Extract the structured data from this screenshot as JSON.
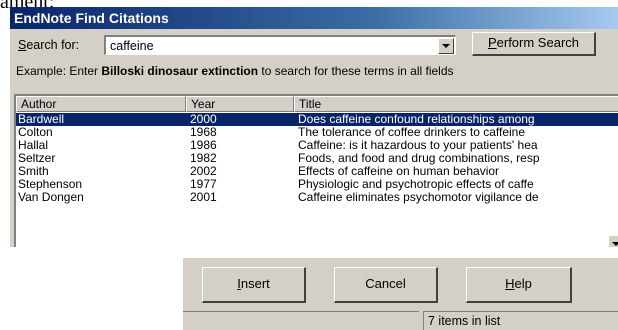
{
  "document_fragment": "ament:",
  "window": {
    "title": "EndNote Find Citations",
    "search_label": "Search for:",
    "search_value": "caffeine",
    "perform_button": "Perform Search",
    "example_prefix": "Example: Enter ",
    "example_bold": "Billoski dinosaur extinction",
    "example_suffix": " to search for these terms in all fields"
  },
  "list": {
    "columns": [
      "Author",
      "Year",
      "Title"
    ],
    "rows": [
      {
        "author": "Bardwell",
        "year": "2000",
        "title": "Does caffeine confound relationships among",
        "selected": true
      },
      {
        "author": "Colton",
        "year": "1968",
        "title": "The tolerance of coffee drinkers to caffeine"
      },
      {
        "author": "Hallal",
        "year": "1986",
        "title": "Caffeine: is it hazardous to your patients' hea"
      },
      {
        "author": "Seltzer",
        "year": "1982",
        "title": "Foods, and food and drug combinations, resp"
      },
      {
        "author": "Smith",
        "year": "2002",
        "title": "Effects of caffeine on human behavior"
      },
      {
        "author": "Stephenson",
        "year": "1977",
        "title": "Physiologic and psychotropic effects of caffe"
      },
      {
        "author": "Van Dongen",
        "year": "2001",
        "title": "Caffeine eliminates psychomotor vigilance de"
      }
    ]
  },
  "buttons": {
    "insert": "Insert",
    "cancel": "Cancel",
    "help": "Help"
  },
  "status": {
    "items": "7 items in list"
  },
  "colors": {
    "titlebar": "#0a246a",
    "selection": "#0a246a",
    "face": "#d4d0c8"
  }
}
